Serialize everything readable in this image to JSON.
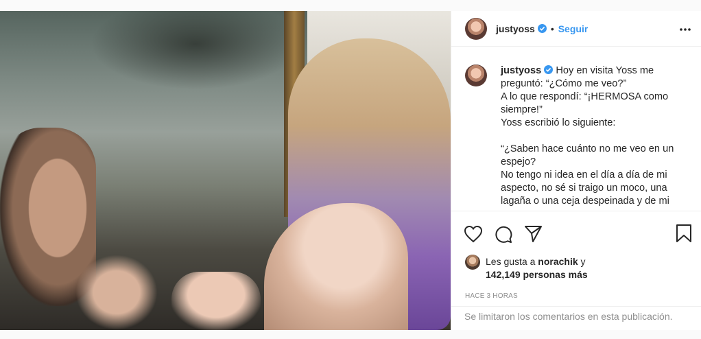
{
  "post": {
    "author": "justyoss",
    "verified": true,
    "separator": "•",
    "follow_label": "Seguir",
    "caption_lines": [
      "Hoy en visita Yoss me",
      "preguntó: “¿Cómo me veo?”",
      "A lo que respondí: “¡HERMOSA como",
      "siempre!”",
      "Yoss escribió lo siguiente:",
      "",
      "“¿Saben hace cuánto no me veo en un",
      "espejo?",
      "No tengo ni idea en el día a día de mi",
      "aspecto, no sé si traigo un moco, una",
      "lagaña o una ceja despeinada y de mi"
    ]
  },
  "likes": {
    "prefix": "Les gusta a",
    "liker": "norachik",
    "conjunction": "y",
    "others": "142,149 personas más"
  },
  "time_ago": "HACE 3 HORAS",
  "comments_disabled": "Se limitaron los comentarios en esta publicación.",
  "icons": {
    "like": "heart-icon",
    "comment": "comment-icon",
    "share": "share-icon",
    "save": "bookmark-icon",
    "options": "more-options-icon",
    "verified": "verified-badge-icon"
  },
  "colors": {
    "link_blue": "#3897f0",
    "text": "#262626",
    "muted": "#8e8e8e"
  }
}
